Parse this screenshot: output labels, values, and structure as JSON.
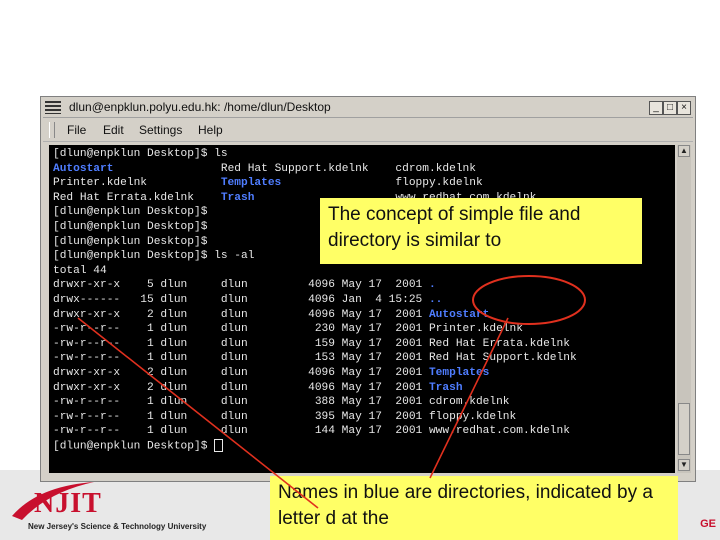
{
  "window": {
    "title": "dlun@enpklun.polyu.edu.hk: /home/dlun/Desktop",
    "minimize_glyph": "_",
    "maximize_glyph": "□",
    "close_glyph": "×"
  },
  "menu": [
    "File",
    "Edit",
    "Settings",
    "Help"
  ],
  "terminal": {
    "lines": [
      {
        "segments": [
          {
            "text": "[dlun@enpklun Desktop]$ ls"
          }
        ]
      },
      {
        "segments": [
          {
            "text": "Autostart",
            "color": "blue"
          },
          {
            "text": "                Red Hat Support.kdelnk    cdrom.kdelnk"
          }
        ]
      },
      {
        "segments": [
          {
            "text": "Printer.kdelnk           "
          },
          {
            "text": "Templates",
            "color": "blue"
          },
          {
            "text": "                 floppy.kdelnk"
          }
        ]
      },
      {
        "segments": [
          {
            "text": "Red Hat Errata.kdelnk    "
          },
          {
            "text": "Trash",
            "color": "blue"
          },
          {
            "text": "                     www.redhat.com.kdelnk"
          }
        ]
      },
      {
        "segments": [
          {
            "text": "[dlun@enpklun Desktop]$"
          }
        ]
      },
      {
        "segments": [
          {
            "text": "[dlun@enpklun Desktop]$"
          }
        ]
      },
      {
        "segments": [
          {
            "text": "[dlun@enpklun Desktop]$"
          }
        ]
      },
      {
        "segments": [
          {
            "text": "[dlun@enpklun Desktop]$ ls -al"
          }
        ]
      },
      {
        "segments": [
          {
            "text": "total 44"
          }
        ]
      },
      {
        "segments": [
          {
            "text": "drwxr-xr-x    5 dlun     dlun         4096 May 17  2001 "
          },
          {
            "text": ".",
            "color": "blue"
          }
        ]
      },
      {
        "segments": [
          {
            "text": "drwx------   15 dlun     dlun         4096 Jan  4 15:25 "
          },
          {
            "text": "..",
            "color": "blue"
          }
        ]
      },
      {
        "segments": [
          {
            "text": "drwxr-xr-x    2 dlun     dlun         4096 May 17  2001 "
          },
          {
            "text": "Autostart",
            "color": "blue"
          }
        ]
      },
      {
        "segments": [
          {
            "text": "-rw-r--r--    1 dlun     dlun          230 May 17  2001 Printer.kdelnk"
          }
        ]
      },
      {
        "segments": [
          {
            "text": "-rw-r--r--    1 dlun     dlun          159 May 17  2001 Red Hat Errata.kdelnk"
          }
        ]
      },
      {
        "segments": [
          {
            "text": "-rw-r--r--    1 dlun     dlun          153 May 17  2001 Red Hat Support.kdelnk"
          }
        ]
      },
      {
        "segments": [
          {
            "text": "drwxr-xr-x    2 dlun     dlun         4096 May 17  2001 "
          },
          {
            "text": "Templates",
            "color": "blue"
          }
        ]
      },
      {
        "segments": [
          {
            "text": "drwxr-xr-x    2 dlun     dlun         4096 May 17  2001 "
          },
          {
            "text": "Trash",
            "color": "blue"
          }
        ]
      },
      {
        "segments": [
          {
            "text": "-rw-r--r--    1 dlun     dlun          388 May 17  2001 cdrom.kdelnk"
          }
        ]
      },
      {
        "segments": [
          {
            "text": "-rw-r--r--    1 dlun     dlun          395 May 17  2001 floppy.kdelnk"
          }
        ]
      },
      {
        "segments": [
          {
            "text": "-rw-r--r--    1 dlun     dlun          144 May 17  2001 www.redhat.com.kdelnk"
          }
        ]
      },
      {
        "segments": [
          {
            "text": "[dlun@enpklun Desktop]$ "
          }
        ],
        "cursor": true
      }
    ]
  },
  "callouts": {
    "top": "The concept of simple file and directory is similar to",
    "bottom": "Names in blue are directories, indicated by a letter d at the"
  },
  "branding": {
    "logo_text": "NJIT",
    "tagline": "New Jersey's Science & Technology University",
    "edge_text": "GE"
  },
  "colors": {
    "directory": "#4f7dff",
    "callout": "#ffff66",
    "arrow": "#e0301e",
    "logo": "#c8102e"
  }
}
